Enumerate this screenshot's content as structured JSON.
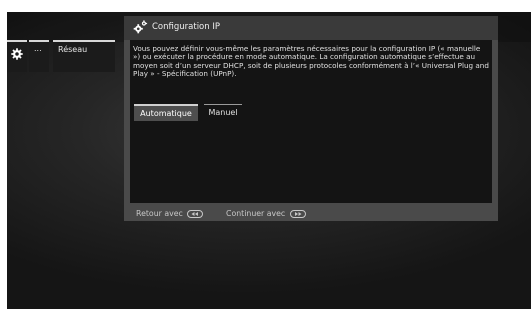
{
  "sidebar": {
    "gear_icon": "gear-icon",
    "more_label": "...",
    "network_label": "Réseau"
  },
  "dialog": {
    "title_icon": "gears-icon",
    "title": "Configuration IP",
    "description": "Vous pouvez définir vous-même les paramètres nécessaires pour la configuration IP (« manuelle ») ou exécuter la procédure en mode automatique. La configuration automatique s’effectue au moyen soit d’un serveur DHCP, soit de plusieurs protocoles conformément à l’« Universal Plug and Play » - Spécification (UPnP).",
    "tabs": [
      {
        "label": "Automatique",
        "selected": true
      },
      {
        "label": "Manuel",
        "selected": false
      }
    ]
  },
  "footer": {
    "back_label": "Retour avec",
    "back_icon": "rewind-button-icon",
    "next_label": "Continuer avec",
    "next_icon": "fast-forward-button-icon"
  }
}
